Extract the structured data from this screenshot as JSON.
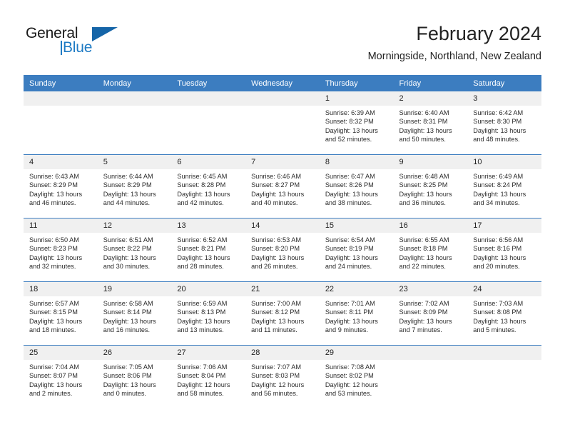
{
  "logo": {
    "word1": "General",
    "word2": "Blue",
    "triangle_color": "#1565a8",
    "blue_color": "#1e7bc4"
  },
  "header": {
    "title": "February 2024",
    "subtitle": "Morningside, Northland, New Zealand"
  },
  "theme": {
    "header_bg": "#3c7dc0",
    "row_divider": "#3c7dc0",
    "daynum_bg": "#f0f0f0"
  },
  "weekdays": [
    "Sunday",
    "Monday",
    "Tuesday",
    "Wednesday",
    "Thursday",
    "Friday",
    "Saturday"
  ],
  "weeks": [
    [
      {
        "day": "",
        "sunrise": "",
        "sunset": "",
        "daylight1": "",
        "daylight2": ""
      },
      {
        "day": "",
        "sunrise": "",
        "sunset": "",
        "daylight1": "",
        "daylight2": ""
      },
      {
        "day": "",
        "sunrise": "",
        "sunset": "",
        "daylight1": "",
        "daylight2": ""
      },
      {
        "day": "",
        "sunrise": "",
        "sunset": "",
        "daylight1": "",
        "daylight2": ""
      },
      {
        "day": "1",
        "sunrise": "Sunrise: 6:39 AM",
        "sunset": "Sunset: 8:32 PM",
        "daylight1": "Daylight: 13 hours",
        "daylight2": "and 52 minutes."
      },
      {
        "day": "2",
        "sunrise": "Sunrise: 6:40 AM",
        "sunset": "Sunset: 8:31 PM",
        "daylight1": "Daylight: 13 hours",
        "daylight2": "and 50 minutes."
      },
      {
        "day": "3",
        "sunrise": "Sunrise: 6:42 AM",
        "sunset": "Sunset: 8:30 PM",
        "daylight1": "Daylight: 13 hours",
        "daylight2": "and 48 minutes."
      }
    ],
    [
      {
        "day": "4",
        "sunrise": "Sunrise: 6:43 AM",
        "sunset": "Sunset: 8:29 PM",
        "daylight1": "Daylight: 13 hours",
        "daylight2": "and 46 minutes."
      },
      {
        "day": "5",
        "sunrise": "Sunrise: 6:44 AM",
        "sunset": "Sunset: 8:29 PM",
        "daylight1": "Daylight: 13 hours",
        "daylight2": "and 44 minutes."
      },
      {
        "day": "6",
        "sunrise": "Sunrise: 6:45 AM",
        "sunset": "Sunset: 8:28 PM",
        "daylight1": "Daylight: 13 hours",
        "daylight2": "and 42 minutes."
      },
      {
        "day": "7",
        "sunrise": "Sunrise: 6:46 AM",
        "sunset": "Sunset: 8:27 PM",
        "daylight1": "Daylight: 13 hours",
        "daylight2": "and 40 minutes."
      },
      {
        "day": "8",
        "sunrise": "Sunrise: 6:47 AM",
        "sunset": "Sunset: 8:26 PM",
        "daylight1": "Daylight: 13 hours",
        "daylight2": "and 38 minutes."
      },
      {
        "day": "9",
        "sunrise": "Sunrise: 6:48 AM",
        "sunset": "Sunset: 8:25 PM",
        "daylight1": "Daylight: 13 hours",
        "daylight2": "and 36 minutes."
      },
      {
        "day": "10",
        "sunrise": "Sunrise: 6:49 AM",
        "sunset": "Sunset: 8:24 PM",
        "daylight1": "Daylight: 13 hours",
        "daylight2": "and 34 minutes."
      }
    ],
    [
      {
        "day": "11",
        "sunrise": "Sunrise: 6:50 AM",
        "sunset": "Sunset: 8:23 PM",
        "daylight1": "Daylight: 13 hours",
        "daylight2": "and 32 minutes."
      },
      {
        "day": "12",
        "sunrise": "Sunrise: 6:51 AM",
        "sunset": "Sunset: 8:22 PM",
        "daylight1": "Daylight: 13 hours",
        "daylight2": "and 30 minutes."
      },
      {
        "day": "13",
        "sunrise": "Sunrise: 6:52 AM",
        "sunset": "Sunset: 8:21 PM",
        "daylight1": "Daylight: 13 hours",
        "daylight2": "and 28 minutes."
      },
      {
        "day": "14",
        "sunrise": "Sunrise: 6:53 AM",
        "sunset": "Sunset: 8:20 PM",
        "daylight1": "Daylight: 13 hours",
        "daylight2": "and 26 minutes."
      },
      {
        "day": "15",
        "sunrise": "Sunrise: 6:54 AM",
        "sunset": "Sunset: 8:19 PM",
        "daylight1": "Daylight: 13 hours",
        "daylight2": "and 24 minutes."
      },
      {
        "day": "16",
        "sunrise": "Sunrise: 6:55 AM",
        "sunset": "Sunset: 8:18 PM",
        "daylight1": "Daylight: 13 hours",
        "daylight2": "and 22 minutes."
      },
      {
        "day": "17",
        "sunrise": "Sunrise: 6:56 AM",
        "sunset": "Sunset: 8:16 PM",
        "daylight1": "Daylight: 13 hours",
        "daylight2": "and 20 minutes."
      }
    ],
    [
      {
        "day": "18",
        "sunrise": "Sunrise: 6:57 AM",
        "sunset": "Sunset: 8:15 PM",
        "daylight1": "Daylight: 13 hours",
        "daylight2": "and 18 minutes."
      },
      {
        "day": "19",
        "sunrise": "Sunrise: 6:58 AM",
        "sunset": "Sunset: 8:14 PM",
        "daylight1": "Daylight: 13 hours",
        "daylight2": "and 16 minutes."
      },
      {
        "day": "20",
        "sunrise": "Sunrise: 6:59 AM",
        "sunset": "Sunset: 8:13 PM",
        "daylight1": "Daylight: 13 hours",
        "daylight2": "and 13 minutes."
      },
      {
        "day": "21",
        "sunrise": "Sunrise: 7:00 AM",
        "sunset": "Sunset: 8:12 PM",
        "daylight1": "Daylight: 13 hours",
        "daylight2": "and 11 minutes."
      },
      {
        "day": "22",
        "sunrise": "Sunrise: 7:01 AM",
        "sunset": "Sunset: 8:11 PM",
        "daylight1": "Daylight: 13 hours",
        "daylight2": "and 9 minutes."
      },
      {
        "day": "23",
        "sunrise": "Sunrise: 7:02 AM",
        "sunset": "Sunset: 8:09 PM",
        "daylight1": "Daylight: 13 hours",
        "daylight2": "and 7 minutes."
      },
      {
        "day": "24",
        "sunrise": "Sunrise: 7:03 AM",
        "sunset": "Sunset: 8:08 PM",
        "daylight1": "Daylight: 13 hours",
        "daylight2": "and 5 minutes."
      }
    ],
    [
      {
        "day": "25",
        "sunrise": "Sunrise: 7:04 AM",
        "sunset": "Sunset: 8:07 PM",
        "daylight1": "Daylight: 13 hours",
        "daylight2": "and 2 minutes."
      },
      {
        "day": "26",
        "sunrise": "Sunrise: 7:05 AM",
        "sunset": "Sunset: 8:06 PM",
        "daylight1": "Daylight: 13 hours",
        "daylight2": "and 0 minutes."
      },
      {
        "day": "27",
        "sunrise": "Sunrise: 7:06 AM",
        "sunset": "Sunset: 8:04 PM",
        "daylight1": "Daylight: 12 hours",
        "daylight2": "and 58 minutes."
      },
      {
        "day": "28",
        "sunrise": "Sunrise: 7:07 AM",
        "sunset": "Sunset: 8:03 PM",
        "daylight1": "Daylight: 12 hours",
        "daylight2": "and 56 minutes."
      },
      {
        "day": "29",
        "sunrise": "Sunrise: 7:08 AM",
        "sunset": "Sunset: 8:02 PM",
        "daylight1": "Daylight: 12 hours",
        "daylight2": "and 53 minutes."
      },
      {
        "day": "",
        "sunrise": "",
        "sunset": "",
        "daylight1": "",
        "daylight2": ""
      },
      {
        "day": "",
        "sunrise": "",
        "sunset": "",
        "daylight1": "",
        "daylight2": ""
      }
    ]
  ]
}
